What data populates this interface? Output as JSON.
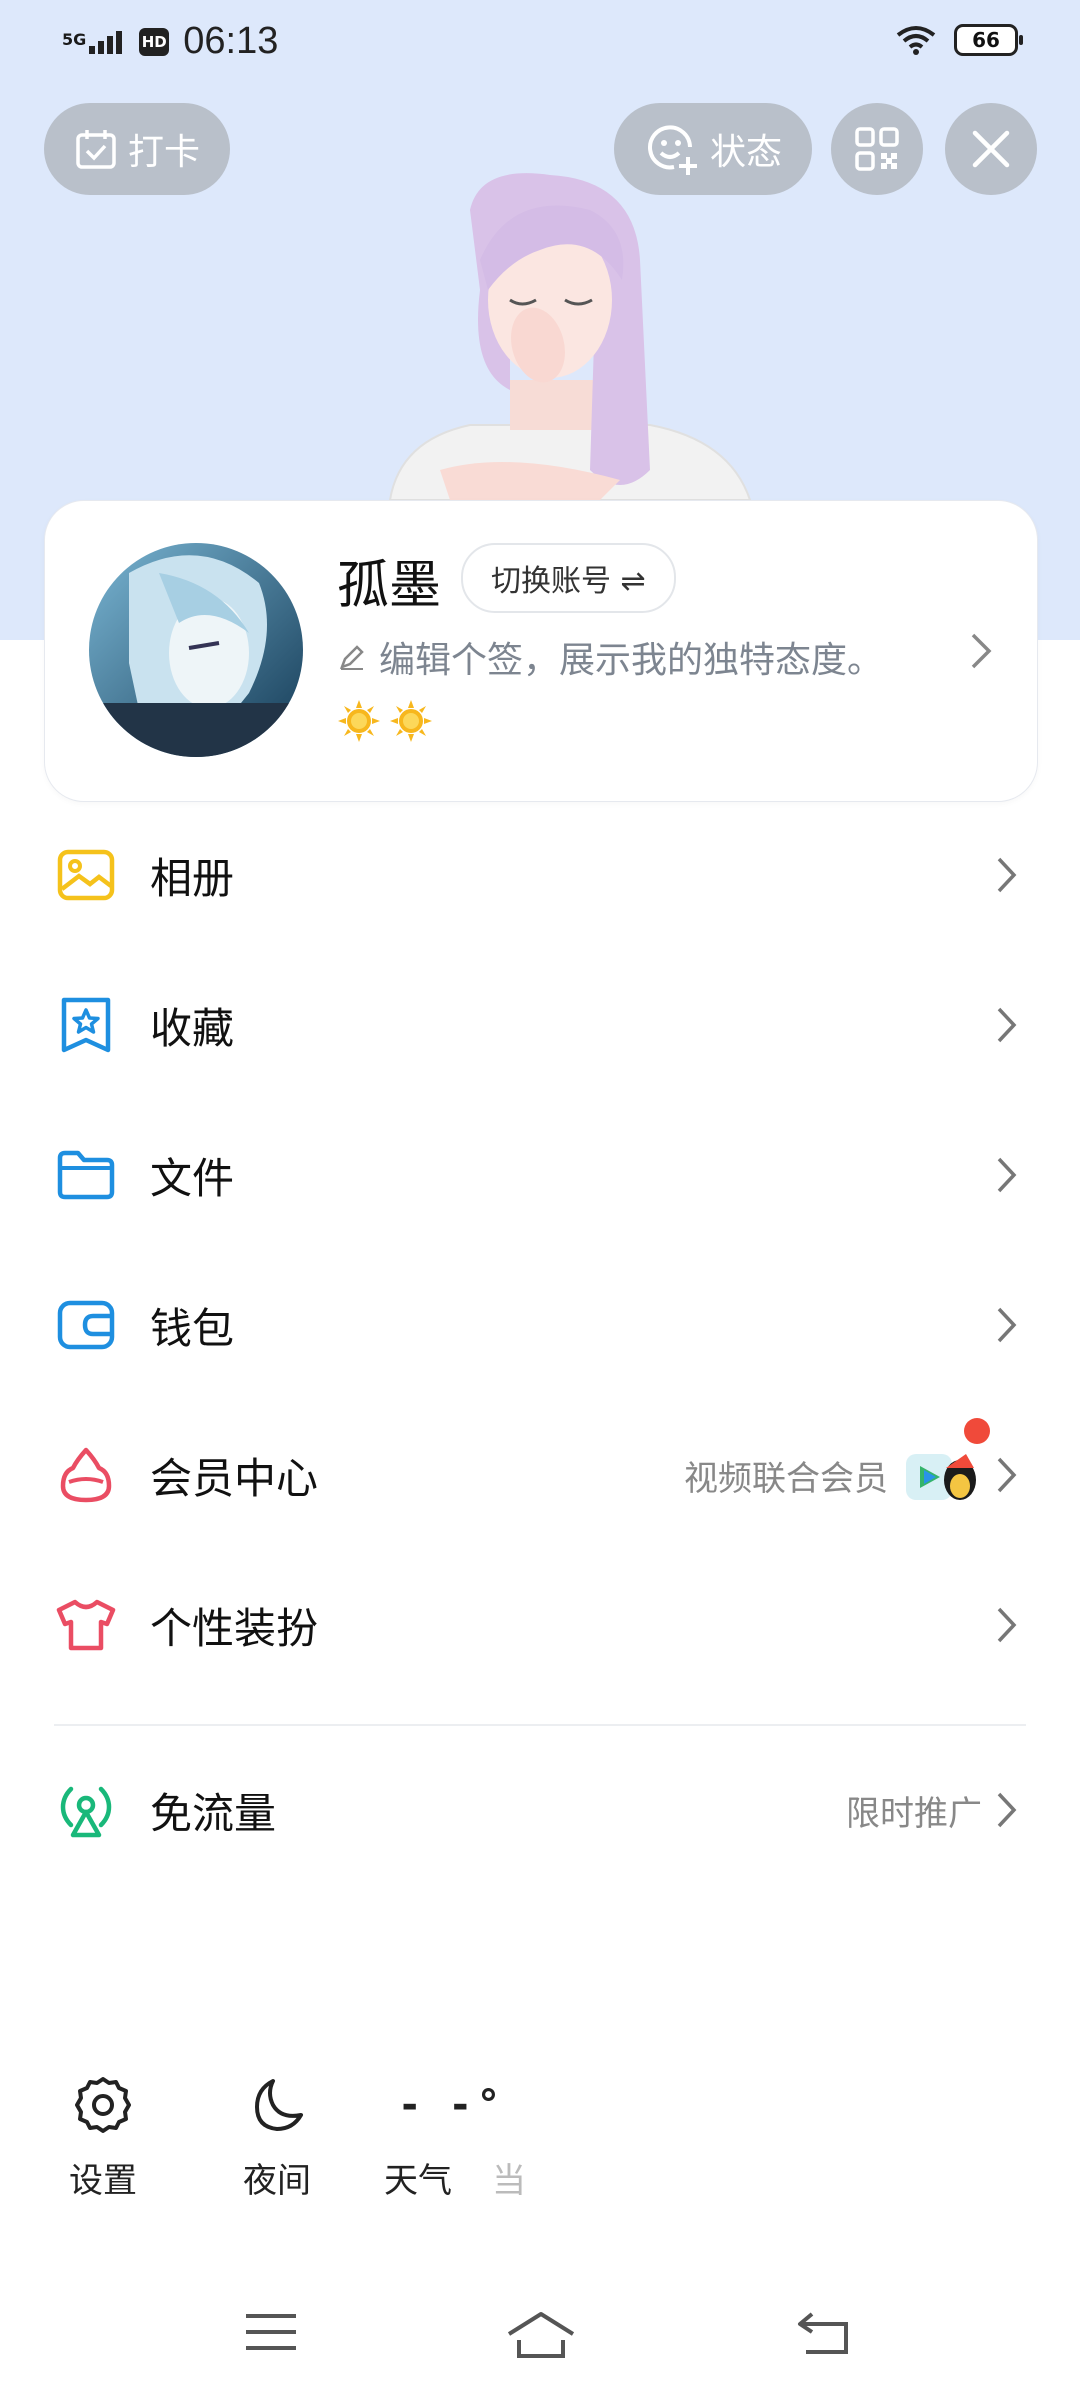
{
  "status_bar": {
    "network": "5G",
    "hd": "HD",
    "time": "06:13",
    "battery": "66"
  },
  "header": {
    "checkin_label": "打卡",
    "status_label": "状态"
  },
  "profile": {
    "nickname": "孤墨",
    "switch_label": "切换账号 ⇌",
    "signature": "编辑个签，展示我的独特态度。"
  },
  "menu": {
    "items": [
      {
        "label": "相册",
        "icon": "album-icon"
      },
      {
        "label": "收藏",
        "icon": "favorites-icon"
      },
      {
        "label": "文件",
        "icon": "folder-icon"
      },
      {
        "label": "钱包",
        "icon": "wallet-icon"
      },
      {
        "label": "会员中心",
        "icon": "vip-icon",
        "sub": "视频联合会员"
      },
      {
        "label": "个性装扮",
        "icon": "tshirt-icon"
      },
      {
        "label": "免流量",
        "icon": "signal-icon",
        "sub": "限时推广"
      }
    ]
  },
  "bottom_tools": {
    "settings_label": "设置",
    "night_label": "夜间",
    "weather_temp": "- -°",
    "weather_label": "天气",
    "weather_sub": "当"
  },
  "colors": {
    "top_bg": "#dde8fb",
    "album": "#f5c21b",
    "favorites": "#1e8fe0",
    "folder": "#1e8fe0",
    "wallet": "#1e8fe0",
    "vip": "#ea4d63",
    "tshirt": "#ea4d63",
    "signal": "#19b87a",
    "badge_red": "#f04a3a"
  }
}
